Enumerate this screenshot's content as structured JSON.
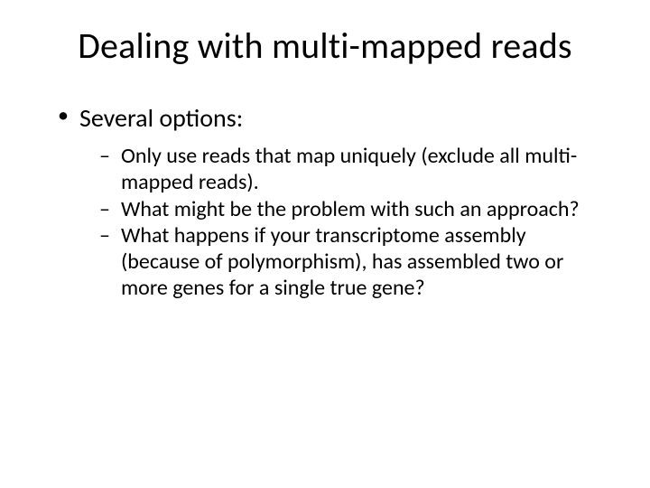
{
  "title": "Dealing with multi-mapped reads",
  "bullets": {
    "level1": [
      {
        "text": "Several options:"
      }
    ],
    "level2": [
      {
        "text": "Only use reads that map uniquely (exclude all multi-mapped reads)."
      },
      {
        "text": "What might be the problem with such an approach?"
      },
      {
        "text": "What happens if your transcriptome assembly (because of polymorphism), has assembled two or more genes for a single true gene?"
      }
    ]
  }
}
